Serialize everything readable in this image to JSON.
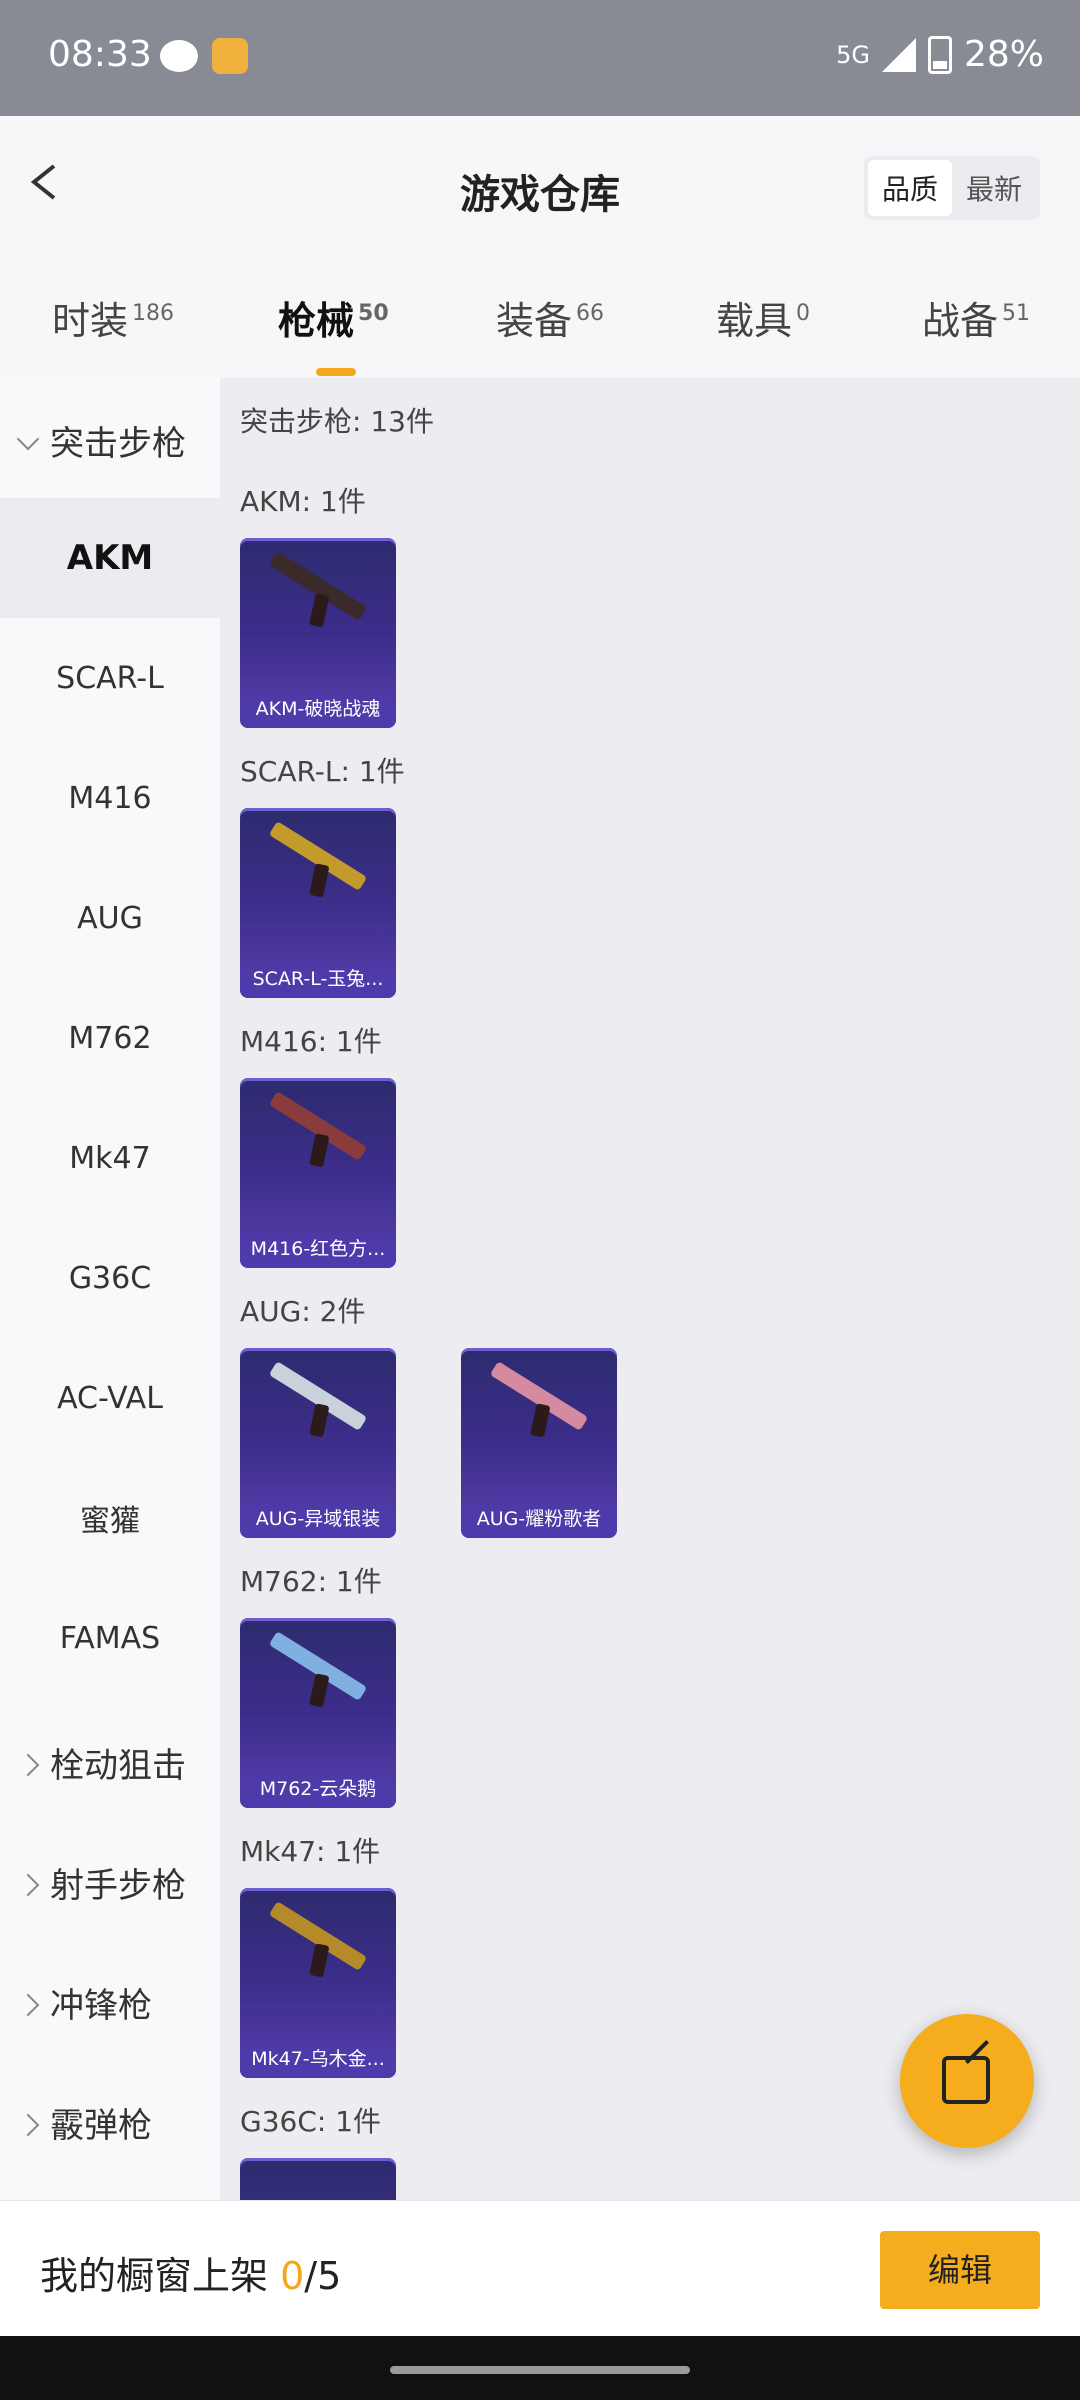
{
  "status": {
    "time": "08:33",
    "network": "5G",
    "battery": "28%"
  },
  "header": {
    "title": "游戏仓库",
    "sort_options": [
      "品质",
      "最新"
    ],
    "sort_selected": "品质"
  },
  "tabs": [
    {
      "label": "时装",
      "count": "186"
    },
    {
      "label": "枪械",
      "count": "50",
      "active": true
    },
    {
      "label": "装备",
      "count": "66"
    },
    {
      "label": "载具",
      "count": "0"
    },
    {
      "label": "战备",
      "count": "51"
    }
  ],
  "sidebar": {
    "category_open": "突击步枪",
    "items": [
      "AKM",
      "SCAR-L",
      "M416",
      "AUG",
      "M762",
      "Mk47",
      "G36C",
      "AC-VAL",
      "蜜獾",
      "FAMAS"
    ],
    "selected": "AKM",
    "categories_collapsed": [
      "栓动狙击",
      "射手步枪",
      "冲锋枪",
      "霰弹枪"
    ]
  },
  "main": {
    "summary": "突击步枪: 13件",
    "groups": [
      {
        "title": "AKM: 1件",
        "items": [
          "AKM-破晓战魂"
        ]
      },
      {
        "title": "SCAR-L: 1件",
        "items": [
          "SCAR-L-玉兔..."
        ]
      },
      {
        "title": "M416: 1件",
        "items": [
          "M416-红色方..."
        ]
      },
      {
        "title": "AUG: 2件",
        "items": [
          "AUG-异域银装",
          "AUG-耀粉歌者"
        ]
      },
      {
        "title": "M762: 1件",
        "items": [
          "M762-云朵鹅"
        ]
      },
      {
        "title": "Mk47: 1件",
        "items": [
          "Mk47-乌木金..."
        ]
      },
      {
        "title": "G36C: 1件",
        "items": []
      }
    ]
  },
  "bottom": {
    "label": "我的橱窗上架 ",
    "count": "0",
    "total": "/5",
    "edit_label": "编辑"
  },
  "colors": {
    "accent": "#f6ad1d",
    "card_bg": "#3c2d8b"
  }
}
